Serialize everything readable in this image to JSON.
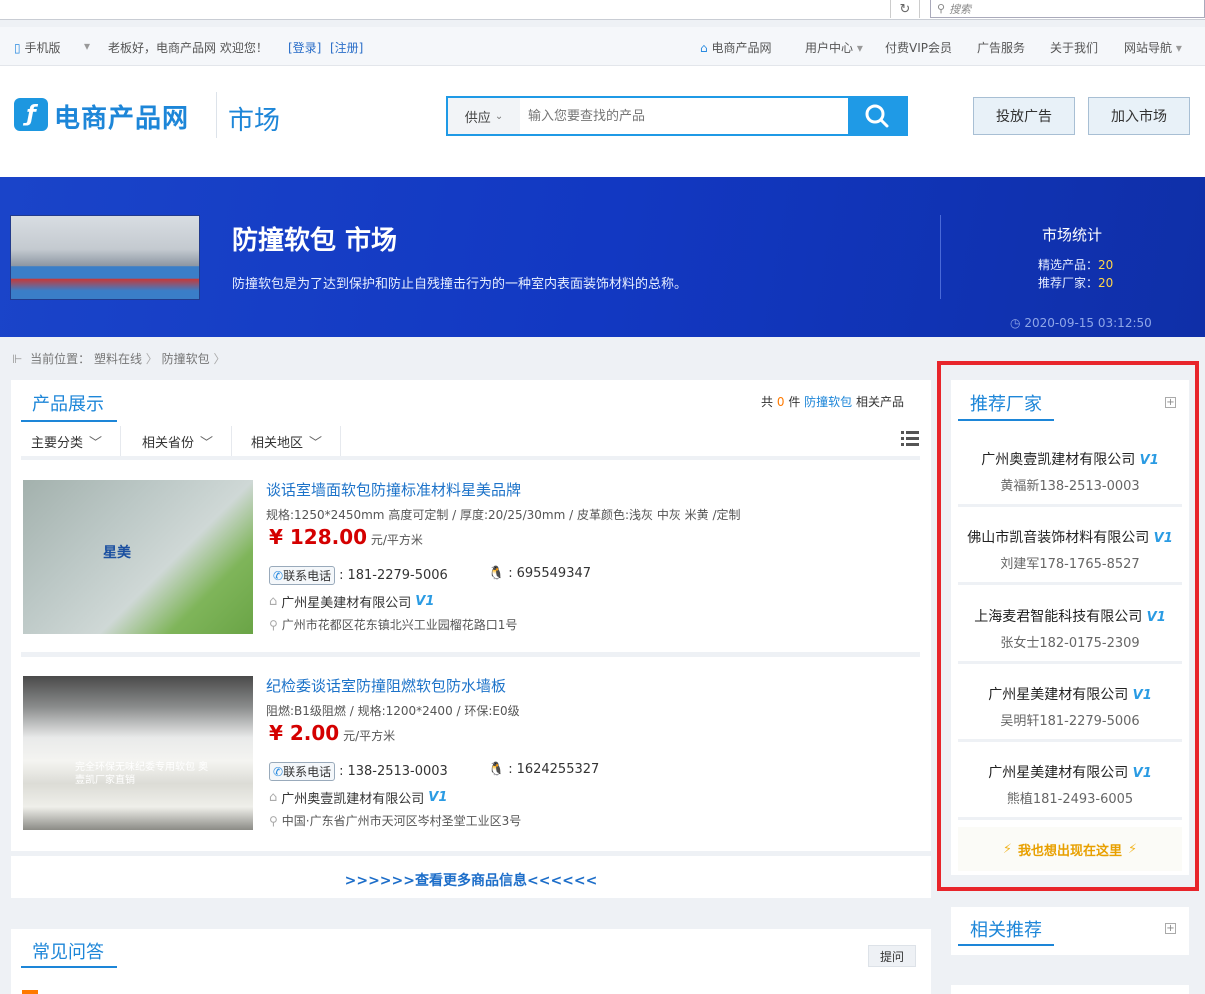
{
  "browser": {
    "search_placeholder": "搜索"
  },
  "topnav": {
    "mobile": "手机版",
    "greeting": "老板好，电商产品网 欢迎您！",
    "login": "[登录]",
    "register": "[注册]",
    "home": "电商产品网",
    "user_center": "用户中心",
    "vip": "付费VIP会员",
    "ad_service": "广告服务",
    "about": "关于我们",
    "site_nav": "网站导航"
  },
  "header": {
    "logo_text": "电商产品网",
    "market": "市场",
    "search_category": "供应",
    "search_placeholder": "输入您要查找的产品",
    "btn_ad": "投放广告",
    "btn_join": "加入市场"
  },
  "banner": {
    "title": "防撞软包 市场",
    "desc": "防撞软包是为了达到保护和防止自残撞击行为的一种室内表面装饰材料的总称。",
    "stats_title": "市场统计",
    "stat1_label": "精选产品：",
    "stat1_value": "20",
    "stat2_label": "推荐厂家：",
    "stat2_value": "20",
    "time": "2020-09-15 03:12:50"
  },
  "breadcrumb": {
    "prefix": "当前位置：",
    "level1": "塑料在线",
    "level2": "防撞软包"
  },
  "products_panel": {
    "title": "产品展示",
    "count_prefix": "共",
    "count": "0",
    "count_unit": "件",
    "keyword": "防撞软包",
    "suffix": "相关产品",
    "filters": [
      "主要分类",
      "相关省份",
      "相关地区"
    ],
    "more": ">>>>>>查看更多商品信息<<<<<<"
  },
  "products": [
    {
      "title": "谈话室墙面软包防撞标准材料星美品牌",
      "spec": "规格:1250*2450mm 高度可定制 / 厚度:20/25/30mm / 皮革颜色:浅灰 中灰 米黄 /定制",
      "price": "¥ 128.00",
      "unit": "元/平方米",
      "phone_label": "联系电话",
      "phone": "181-2279-5006",
      "qq": "695549347",
      "company": "广州星美建材有限公司",
      "address": "广州市花都区花东镇北兴工业园榴花路口1号",
      "img_text": "星美"
    },
    {
      "title": "纪检委谈话室防撞阻燃软包防水墙板",
      "spec": "阻燃:B1级阻燃 / 规格:1200*2400 / 环保:E0级",
      "price": "¥ 2.00",
      "unit": "元/平方米",
      "phone_label": "联系电话",
      "phone": "138-2513-0003",
      "qq": "1624255327",
      "company": "广州奥壹凯建材有限公司",
      "address": "中国·广东省广州市天河区岑村圣堂工业区3号",
      "img_text": "完全环保无味纪委专用软包 奥壹凯厂家直销"
    }
  ],
  "faq": {
    "title": "常见问答",
    "ask": "提问"
  },
  "recommend": {
    "title": "推荐厂家",
    "items": [
      {
        "name": "广州奥壹凯建材有限公司",
        "phone": "黄福新138-2513-0003"
      },
      {
        "name": "佛山市凯音装饰材料有限公司",
        "phone": "刘建军178-1765-8527"
      },
      {
        "name": "上海麦君智能科技有限公司",
        "phone": "张女士182-0175-2309"
      },
      {
        "name": "广州星美建材有限公司",
        "phone": "吴明轩181-2279-5006"
      },
      {
        "name": "广州星美建材有限公司",
        "phone": "熊植181-2493-6005"
      }
    ],
    "cta": "我也想出现在这里",
    "badge": "V1"
  },
  "related": {
    "title": "相关推荐"
  },
  "colors": {
    "accent": "#1d86d8",
    "price": "#d40000",
    "banner": "#1238c2",
    "highlight": "#e8252b"
  }
}
